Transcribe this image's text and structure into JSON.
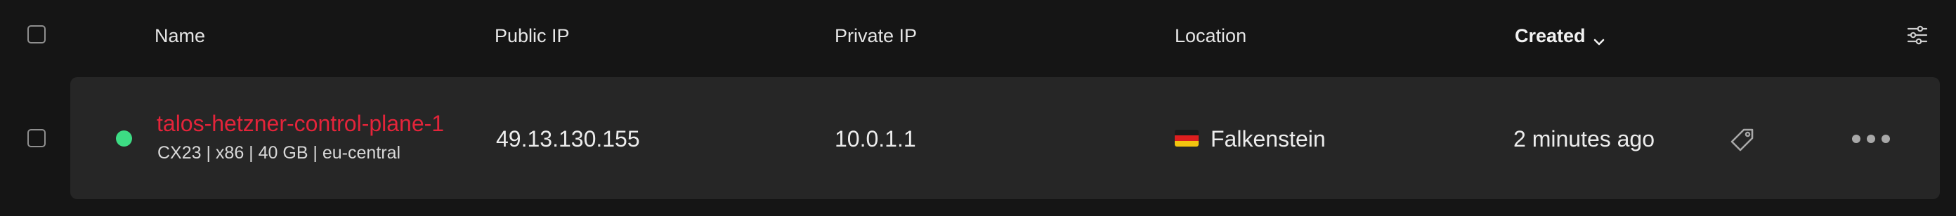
{
  "table": {
    "columns": {
      "name": "Name",
      "public_ip": "Public IP",
      "private_ip": "Private IP",
      "location": "Location",
      "created": "Created"
    },
    "sort": {
      "column": "Created",
      "direction": "descending",
      "icon": "chevron-down-icon"
    },
    "settings_icon": "sliders-icon"
  },
  "servers": [
    {
      "name": "talos-hetzner-control-plane-1",
      "specs": "CX23 | x86 | 40 GB | eu-central",
      "status": "running",
      "status_color": "#3ddc84",
      "public_ip": "49.13.130.155",
      "private_ip": "10.0.1.1",
      "location": "Falkenstein",
      "location_flag": "flag-germany-icon",
      "created": "2 minutes ago",
      "actions": [
        "label-tag-icon",
        "more-horizontal-icon"
      ]
    }
  ],
  "colors": {
    "background": "#151515",
    "row_background": "#262626",
    "server_name": "#e3243a",
    "status_running": "#3ddc84"
  }
}
